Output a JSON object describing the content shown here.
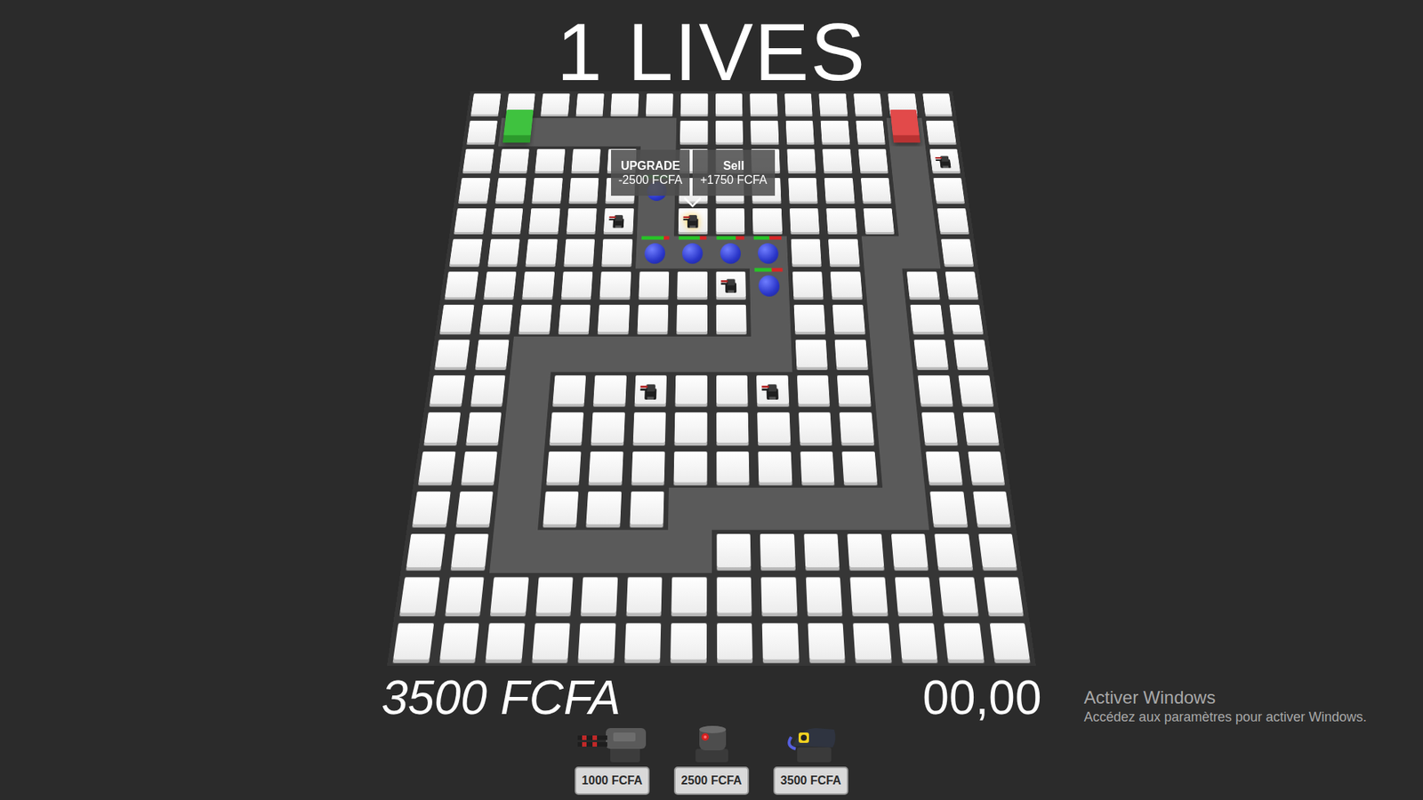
{
  "hud": {
    "lives": "1 LIVES",
    "money": "3500 FCFA",
    "timer": "00,00"
  },
  "board": {
    "rows": 16,
    "cols": 14,
    "start": [
      1,
      1
    ],
    "end": [
      1,
      12
    ],
    "path": [
      [
        1,
        2
      ],
      [
        1,
        3
      ],
      [
        1,
        4
      ],
      [
        1,
        5
      ],
      [
        2,
        5
      ],
      [
        3,
        5
      ],
      [
        4,
        5
      ],
      [
        5,
        5
      ],
      [
        5,
        6
      ],
      [
        5,
        7
      ],
      [
        5,
        8
      ],
      [
        6,
        8
      ],
      [
        7,
        8
      ],
      [
        8,
        8
      ],
      [
        8,
        7
      ],
      [
        8,
        6
      ],
      [
        8,
        5
      ],
      [
        8,
        4
      ],
      [
        8,
        3
      ],
      [
        8,
        2
      ],
      [
        9,
        2
      ],
      [
        10,
        2
      ],
      [
        11,
        2
      ],
      [
        12,
        2
      ],
      [
        13,
        2
      ],
      [
        13,
        3
      ],
      [
        13,
        4
      ],
      [
        13,
        5
      ],
      [
        13,
        6
      ],
      [
        12,
        6
      ],
      [
        12,
        7
      ],
      [
        12,
        8
      ],
      [
        12,
        9
      ],
      [
        12,
        10
      ],
      [
        12,
        11
      ],
      [
        11,
        11
      ],
      [
        10,
        11
      ],
      [
        9,
        11
      ],
      [
        8,
        11
      ],
      [
        7,
        11
      ],
      [
        6,
        11
      ],
      [
        5,
        11
      ],
      [
        5,
        12
      ],
      [
        4,
        12
      ],
      [
        3,
        12
      ],
      [
        2,
        12
      ]
    ]
  },
  "towers": [
    {
      "row": 4,
      "col": 4,
      "selected": false
    },
    {
      "row": 4,
      "col": 6,
      "selected": true
    },
    {
      "row": 6,
      "col": 7,
      "selected": false
    },
    {
      "row": 9,
      "col": 5,
      "selected": false
    },
    {
      "row": 9,
      "col": 8,
      "selected": false
    },
    {
      "row": 2,
      "col": 13,
      "selected": false
    }
  ],
  "enemies": [
    {
      "row": 3,
      "col": 5,
      "level": 1.0
    },
    {
      "row": 5,
      "col": 5,
      "level": 0.8
    },
    {
      "row": 5,
      "col": 6,
      "level": 0.75
    },
    {
      "row": 5,
      "col": 7,
      "level": 0.7
    },
    {
      "row": 5,
      "col": 8,
      "level": 0.55
    },
    {
      "row": 6,
      "col": 8,
      "level": 0.6
    }
  ],
  "tower_menu": {
    "upgrade_label": "UPGRADE",
    "upgrade_cost": "-2500 FCFA",
    "sell_label": "Sell",
    "sell_value": "+1750 FCFA"
  },
  "shop": [
    {
      "price": "1000 FCFA",
      "kind": "cannon"
    },
    {
      "price": "2500 FCFA",
      "kind": "laser"
    },
    {
      "price": "3500 FCFA",
      "kind": "beam"
    }
  ],
  "watermark": {
    "title": "Activer Windows",
    "subtitle": "Accédez aux paramètres pour activer Windows."
  }
}
